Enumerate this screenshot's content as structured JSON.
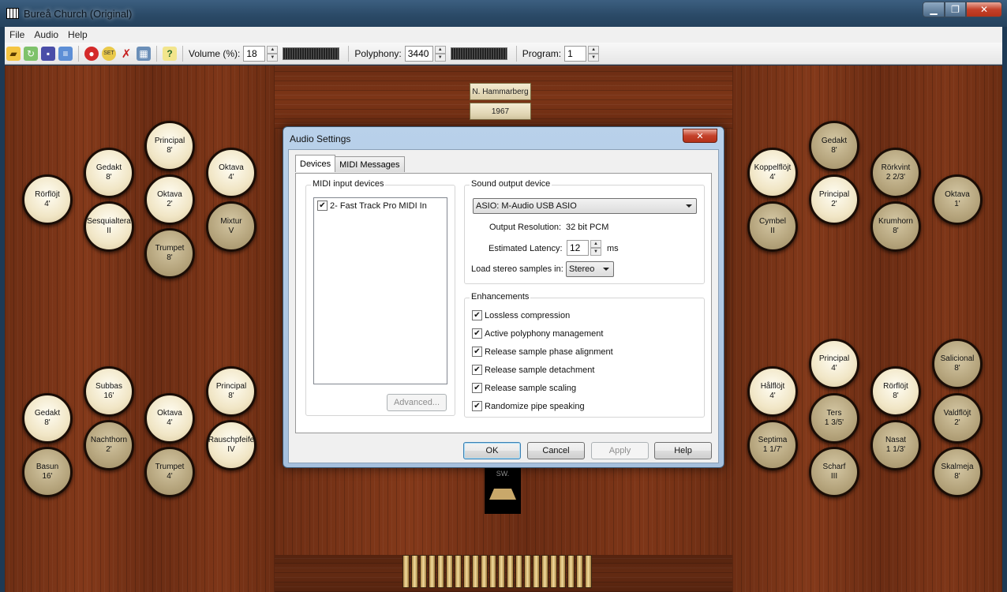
{
  "window": {
    "title": "Bureå Church (Original)",
    "min_symbol": "▁",
    "max_symbol": "❐",
    "close_symbol": "✕"
  },
  "menu": [
    "File",
    "Audio",
    "Help"
  ],
  "toolbar": {
    "volume_label": "Volume (%):",
    "volume_value": "18",
    "polyphony_label": "Polyphony:",
    "polyphony_value": "3440",
    "program_label": "Program:",
    "program_value": "1",
    "icons": [
      "open-icon",
      "reload-icon",
      "save-icon",
      "properties-icon",
      "record-icon",
      "settings-icon",
      "panic-icon",
      "audio-settings-icon",
      "help-icon"
    ]
  },
  "plates": {
    "builder": "N. Hammarberg",
    "year": "1967"
  },
  "swell_label": "SW.",
  "stops": [
    {
      "name": "Principal",
      "pitch": "8'",
      "on": true
    },
    {
      "name": "Gedakt",
      "pitch": "8'",
      "on": true
    },
    {
      "name": "Oktava",
      "pitch": "4'",
      "on": true
    },
    {
      "name": "Rörflöjt",
      "pitch": "4'",
      "on": true
    },
    {
      "name": "Oktava",
      "pitch": "2'",
      "on": true
    },
    {
      "name": "Sesquialtera",
      "pitch": "II",
      "on": true
    },
    {
      "name": "Mixtur",
      "pitch": "V",
      "on": false
    },
    {
      "name": "Trumpet",
      "pitch": "8'",
      "on": false
    },
    {
      "name": "Subbas",
      "pitch": "16'",
      "on": true
    },
    {
      "name": "Principal",
      "pitch": "8'",
      "on": true
    },
    {
      "name": "Gedakt",
      "pitch": "8'",
      "on": true
    },
    {
      "name": "Oktava",
      "pitch": "4'",
      "on": true
    },
    {
      "name": "Nachthorn",
      "pitch": "2'",
      "on": false
    },
    {
      "name": "Rauschpfeife",
      "pitch": "IV",
      "on": true
    },
    {
      "name": "Basun",
      "pitch": "16'",
      "on": false
    },
    {
      "name": "Trumpet",
      "pitch": "4'",
      "on": false
    },
    {
      "name": "Gedakt",
      "pitch": "8'",
      "on": false
    },
    {
      "name": "Koppelflöjt",
      "pitch": "4'",
      "on": true
    },
    {
      "name": "Rörkvint",
      "pitch": "2 2/3'",
      "on": false
    },
    {
      "name": "Principal",
      "pitch": "2'",
      "on": true
    },
    {
      "name": "Oktava",
      "pitch": "1'",
      "on": false
    },
    {
      "name": "Cymbel",
      "pitch": "II",
      "on": false
    },
    {
      "name": "Krumhorn",
      "pitch": "8'",
      "on": false
    },
    {
      "name": "Principal",
      "pitch": "4'",
      "on": true
    },
    {
      "name": "Salicional",
      "pitch": "8'",
      "on": false
    },
    {
      "name": "Hålflöjt",
      "pitch": "4'",
      "on": true
    },
    {
      "name": "Rörflöjt",
      "pitch": "8'",
      "on": true
    },
    {
      "name": "Ters",
      "pitch": "1 3/5'",
      "on": false
    },
    {
      "name": "Valdflöjt",
      "pitch": "2'",
      "on": false
    },
    {
      "name": "Septima",
      "pitch": "1 1/7'",
      "on": false
    },
    {
      "name": "Nasat",
      "pitch": "1 1/3'",
      "on": false
    },
    {
      "name": "Scharf",
      "pitch": "III",
      "on": false
    },
    {
      "name": "Skalmeja",
      "pitch": "8'",
      "on": false
    }
  ],
  "dialog": {
    "title": "Audio Settings",
    "close_symbol": "✕",
    "tabs": [
      "Devices",
      "MIDI Messages"
    ],
    "midi_group_title": "MIDI input devices",
    "midi_devices": [
      {
        "label": "2- Fast Track Pro MIDI In",
        "checked": true
      }
    ],
    "advanced_button": "Advanced...",
    "sound_group_title": "Sound output device",
    "sound_device": "ASIO: M-Audio USB ASIO",
    "output_resolution_label": "Output Resolution:",
    "output_resolution_value": "32 bit PCM",
    "latency_label": "Estimated Latency:",
    "latency_value": "12",
    "latency_unit": "ms",
    "stereo_label": "Load stereo samples in:",
    "stereo_value": "Stereo",
    "enh_group_title": "Enhancements",
    "enhancements": [
      {
        "label": "Lossless compression",
        "checked": true
      },
      {
        "label": "Active polyphony management",
        "checked": true
      },
      {
        "label": "Release sample phase alignment",
        "checked": true
      },
      {
        "label": "Release sample detachment",
        "checked": true
      },
      {
        "label": "Release sample scaling",
        "checked": true
      },
      {
        "label": "Randomize pipe speaking",
        "checked": true
      }
    ],
    "buttons": {
      "ok": "OK",
      "cancel": "Cancel",
      "apply": "Apply",
      "help": "Help"
    }
  }
}
